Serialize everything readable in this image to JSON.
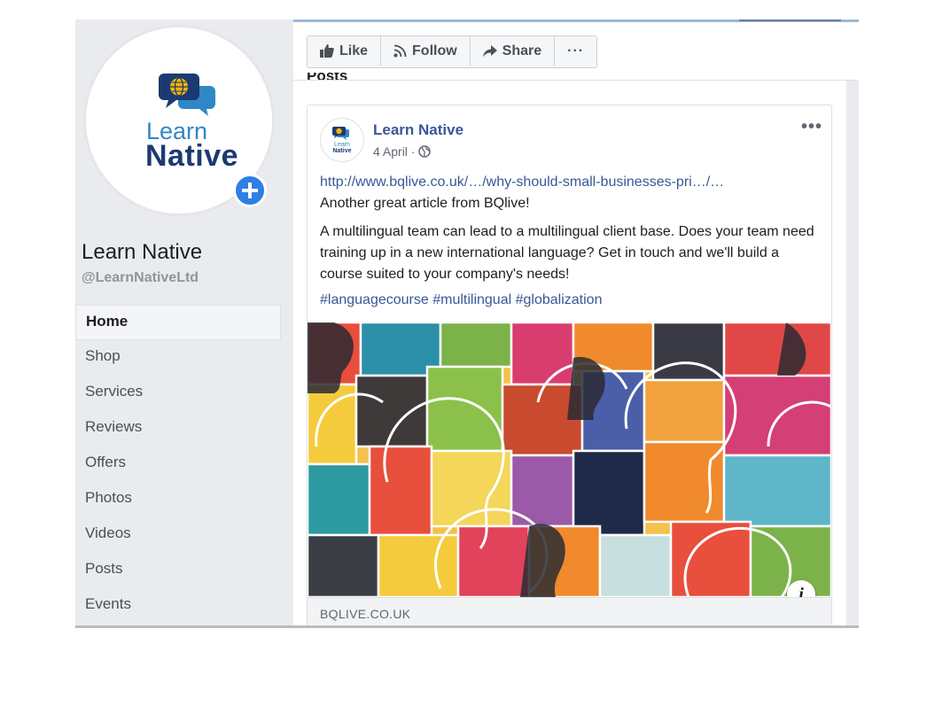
{
  "page": {
    "name": "Learn Native",
    "handle": "@LearnNativeLtd",
    "logo_words": [
      "Learn",
      "Native"
    ]
  },
  "nav": {
    "items": [
      "Home",
      "Shop",
      "Services",
      "Reviews",
      "Offers",
      "Photos",
      "Videos",
      "Posts",
      "Events"
    ],
    "active": "Home"
  },
  "actions": {
    "like": "Like",
    "follow": "Follow",
    "share": "Share",
    "more": "···"
  },
  "section_heading": "Posts",
  "post": {
    "author": "Learn Native",
    "date": "4 April ·",
    "options": "•••",
    "link": "http://www.bqlive.co.uk/…/why-should-small-businesses-pri…/…",
    "line1": "Another great article from BQlive!",
    "body": "A multilingual team can lead to a multilingual client base. Does your team need training up in a new international language? Get in touch and we'll build a course suited to your company's needs!",
    "hashtags": [
      "#languagecourse",
      "#multilingual",
      "#globalization"
    ],
    "link_domain": "BQLIVE.CO.UK",
    "info": "i"
  },
  "icons": {
    "like": "thumbs-up-icon",
    "follow": "rss-icon",
    "share": "share-arrow-icon",
    "audience": "globe-icon",
    "add": "plus-icon"
  },
  "colors": {
    "link_blue": "#385898",
    "add_button": "#2f7fe4",
    "logo_dark": "#1c3a72",
    "logo_light": "#2f88c6"
  }
}
